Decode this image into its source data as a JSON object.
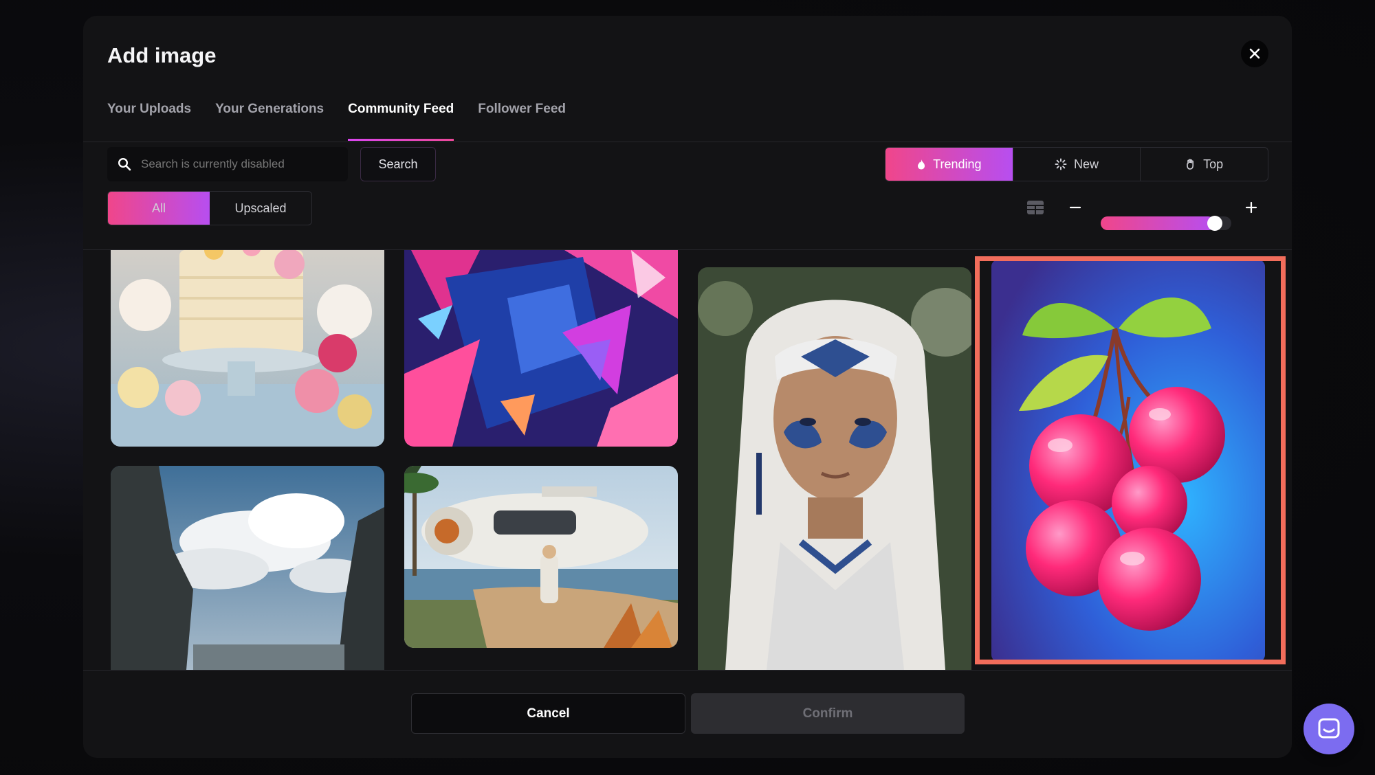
{
  "dialog": {
    "title": "Add image"
  },
  "tabs": [
    {
      "label": "Your Uploads",
      "active": false
    },
    {
      "label": "Your Generations",
      "active": false
    },
    {
      "label": "Community Feed",
      "active": true
    },
    {
      "label": "Follower Feed",
      "active": false
    }
  ],
  "search": {
    "placeholder": "Search is currently disabled",
    "button_label": "Search"
  },
  "sort": {
    "options": [
      {
        "label": "Trending",
        "icon": "flame-icon",
        "active": true
      },
      {
        "label": "New",
        "icon": "spinner-icon",
        "active": false
      },
      {
        "label": "Top",
        "icon": "hand-icon",
        "active": false
      }
    ]
  },
  "filter": {
    "options": [
      {
        "label": "All",
        "active": true
      },
      {
        "label": "Upscaled",
        "active": false
      }
    ]
  },
  "zoom": {
    "level": 0.92
  },
  "images": [
    {
      "name": "cake-with-flowers",
      "selected": false
    },
    {
      "name": "abstract-blue-pink-figure",
      "selected": false
    },
    {
      "name": "woman-with-face-paint",
      "selected": false
    },
    {
      "name": "neon-cherries",
      "selected": true
    },
    {
      "name": "cliffs-and-clouds",
      "selected": false
    },
    {
      "name": "spaceship-tropical-harbor",
      "selected": false
    }
  ],
  "footer": {
    "cancel_label": "Cancel",
    "confirm_label": "Confirm"
  },
  "colors": {
    "accent_start": "#f0468a",
    "accent_end": "#b74ef0",
    "selection": "#f26d5b",
    "chat": "#7c6cf0"
  }
}
